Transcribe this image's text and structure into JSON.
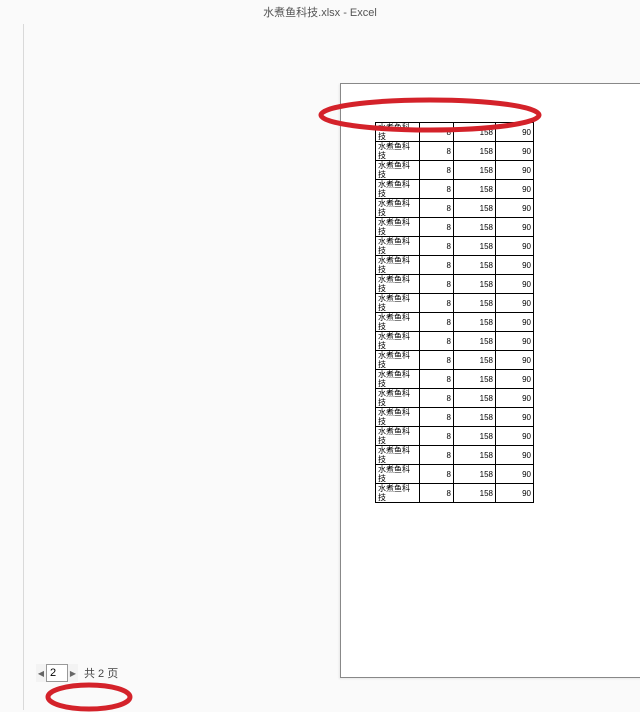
{
  "title": "水煮鱼科技.xlsx  -  Excel",
  "table": {
    "rows": [
      [
        "水煮鱼科技",
        "8",
        "158",
        "90"
      ],
      [
        "水煮鱼科技",
        "8",
        "158",
        "90"
      ],
      [
        "水煮鱼科技",
        "8",
        "158",
        "90"
      ],
      [
        "水煮鱼科技",
        "8",
        "158",
        "90"
      ],
      [
        "水煮鱼科技",
        "8",
        "158",
        "90"
      ],
      [
        "水煮鱼科技",
        "8",
        "158",
        "90"
      ],
      [
        "水煮鱼科技",
        "8",
        "158",
        "90"
      ],
      [
        "水煮鱼科技",
        "8",
        "158",
        "90"
      ],
      [
        "水煮鱼科技",
        "8",
        "158",
        "90"
      ],
      [
        "水煮鱼科技",
        "8",
        "158",
        "90"
      ],
      [
        "水煮鱼科技",
        "8",
        "158",
        "90"
      ],
      [
        "水煮鱼科技",
        "8",
        "158",
        "90"
      ],
      [
        "水煮鱼科技",
        "8",
        "158",
        "90"
      ],
      [
        "水煮鱼科技",
        "8",
        "158",
        "90"
      ],
      [
        "水煮鱼科技",
        "8",
        "158",
        "90"
      ],
      [
        "水煮鱼科技",
        "8",
        "158",
        "90"
      ],
      [
        "水煮鱼科技",
        "8",
        "158",
        "90"
      ],
      [
        "水煮鱼科技",
        "8",
        "158",
        "90"
      ],
      [
        "水煮鱼科技",
        "8",
        "158",
        "90"
      ],
      [
        "水煮鱼科技",
        "8",
        "158",
        "90"
      ]
    ]
  },
  "pager": {
    "prev": "◀",
    "current": "2",
    "next": "▶",
    "total": "共 2 页"
  }
}
